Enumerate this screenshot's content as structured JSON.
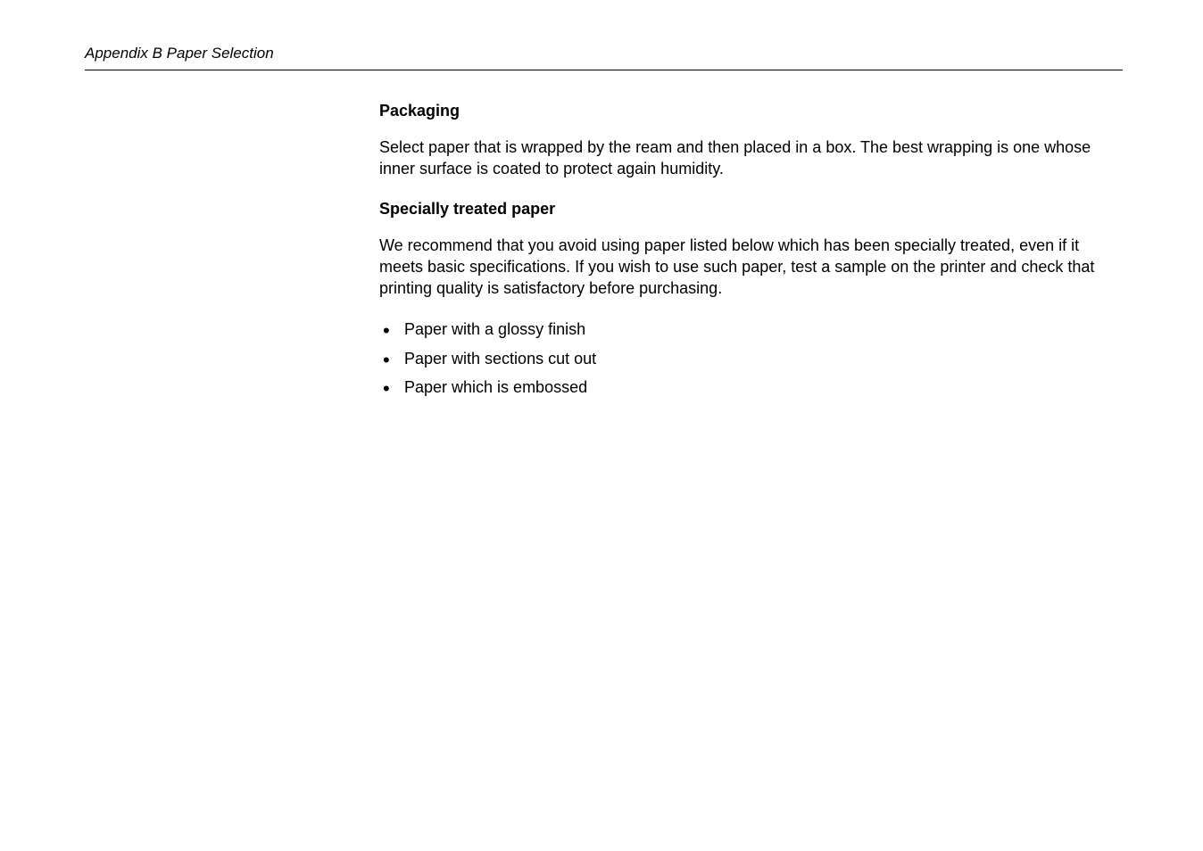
{
  "header": {
    "label": "Appendix B  Paper Selection"
  },
  "sections": {
    "packaging": {
      "heading": "Packaging",
      "paragraph": "Select paper that is wrapped by the ream and then placed in a box.  The best wrapping is one whose inner surface is coated to protect again humidity."
    },
    "specially_treated": {
      "heading": "Specially treated paper",
      "paragraph": "We recommend that you avoid using paper listed below which has been specially treated, even if it meets basic specifications.  If you wish to use such paper, test a sample on the printer and check that printing quality is satisfactory before purchasing.",
      "bullets": [
        "Paper with a glossy finish",
        "Paper with sections cut out",
        "Paper which is embossed"
      ]
    }
  }
}
